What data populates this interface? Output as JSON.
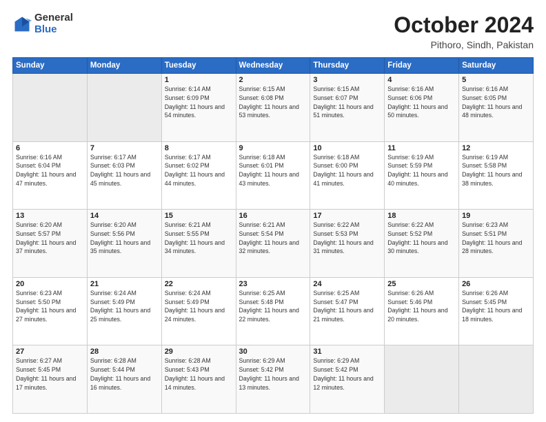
{
  "logo": {
    "general": "General",
    "blue": "Blue"
  },
  "header": {
    "month": "October 2024",
    "location": "Pithoro, Sindh, Pakistan"
  },
  "weekdays": [
    "Sunday",
    "Monday",
    "Tuesday",
    "Wednesday",
    "Thursday",
    "Friday",
    "Saturday"
  ],
  "weeks": [
    [
      {
        "day": "",
        "info": ""
      },
      {
        "day": "",
        "info": ""
      },
      {
        "day": "1",
        "info": "Sunrise: 6:14 AM\nSunset: 6:09 PM\nDaylight: 11 hours and 54 minutes."
      },
      {
        "day": "2",
        "info": "Sunrise: 6:15 AM\nSunset: 6:08 PM\nDaylight: 11 hours and 53 minutes."
      },
      {
        "day": "3",
        "info": "Sunrise: 6:15 AM\nSunset: 6:07 PM\nDaylight: 11 hours and 51 minutes."
      },
      {
        "day": "4",
        "info": "Sunrise: 6:16 AM\nSunset: 6:06 PM\nDaylight: 11 hours and 50 minutes."
      },
      {
        "day": "5",
        "info": "Sunrise: 6:16 AM\nSunset: 6:05 PM\nDaylight: 11 hours and 48 minutes."
      }
    ],
    [
      {
        "day": "6",
        "info": "Sunrise: 6:16 AM\nSunset: 6:04 PM\nDaylight: 11 hours and 47 minutes."
      },
      {
        "day": "7",
        "info": "Sunrise: 6:17 AM\nSunset: 6:03 PM\nDaylight: 11 hours and 45 minutes."
      },
      {
        "day": "8",
        "info": "Sunrise: 6:17 AM\nSunset: 6:02 PM\nDaylight: 11 hours and 44 minutes."
      },
      {
        "day": "9",
        "info": "Sunrise: 6:18 AM\nSunset: 6:01 PM\nDaylight: 11 hours and 43 minutes."
      },
      {
        "day": "10",
        "info": "Sunrise: 6:18 AM\nSunset: 6:00 PM\nDaylight: 11 hours and 41 minutes."
      },
      {
        "day": "11",
        "info": "Sunrise: 6:19 AM\nSunset: 5:59 PM\nDaylight: 11 hours and 40 minutes."
      },
      {
        "day": "12",
        "info": "Sunrise: 6:19 AM\nSunset: 5:58 PM\nDaylight: 11 hours and 38 minutes."
      }
    ],
    [
      {
        "day": "13",
        "info": "Sunrise: 6:20 AM\nSunset: 5:57 PM\nDaylight: 11 hours and 37 minutes."
      },
      {
        "day": "14",
        "info": "Sunrise: 6:20 AM\nSunset: 5:56 PM\nDaylight: 11 hours and 35 minutes."
      },
      {
        "day": "15",
        "info": "Sunrise: 6:21 AM\nSunset: 5:55 PM\nDaylight: 11 hours and 34 minutes."
      },
      {
        "day": "16",
        "info": "Sunrise: 6:21 AM\nSunset: 5:54 PM\nDaylight: 11 hours and 32 minutes."
      },
      {
        "day": "17",
        "info": "Sunrise: 6:22 AM\nSunset: 5:53 PM\nDaylight: 11 hours and 31 minutes."
      },
      {
        "day": "18",
        "info": "Sunrise: 6:22 AM\nSunset: 5:52 PM\nDaylight: 11 hours and 30 minutes."
      },
      {
        "day": "19",
        "info": "Sunrise: 6:23 AM\nSunset: 5:51 PM\nDaylight: 11 hours and 28 minutes."
      }
    ],
    [
      {
        "day": "20",
        "info": "Sunrise: 6:23 AM\nSunset: 5:50 PM\nDaylight: 11 hours and 27 minutes."
      },
      {
        "day": "21",
        "info": "Sunrise: 6:24 AM\nSunset: 5:49 PM\nDaylight: 11 hours and 25 minutes."
      },
      {
        "day": "22",
        "info": "Sunrise: 6:24 AM\nSunset: 5:49 PM\nDaylight: 11 hours and 24 minutes."
      },
      {
        "day": "23",
        "info": "Sunrise: 6:25 AM\nSunset: 5:48 PM\nDaylight: 11 hours and 22 minutes."
      },
      {
        "day": "24",
        "info": "Sunrise: 6:25 AM\nSunset: 5:47 PM\nDaylight: 11 hours and 21 minutes."
      },
      {
        "day": "25",
        "info": "Sunrise: 6:26 AM\nSunset: 5:46 PM\nDaylight: 11 hours and 20 minutes."
      },
      {
        "day": "26",
        "info": "Sunrise: 6:26 AM\nSunset: 5:45 PM\nDaylight: 11 hours and 18 minutes."
      }
    ],
    [
      {
        "day": "27",
        "info": "Sunrise: 6:27 AM\nSunset: 5:45 PM\nDaylight: 11 hours and 17 minutes."
      },
      {
        "day": "28",
        "info": "Sunrise: 6:28 AM\nSunset: 5:44 PM\nDaylight: 11 hours and 16 minutes."
      },
      {
        "day": "29",
        "info": "Sunrise: 6:28 AM\nSunset: 5:43 PM\nDaylight: 11 hours and 14 minutes."
      },
      {
        "day": "30",
        "info": "Sunrise: 6:29 AM\nSunset: 5:42 PM\nDaylight: 11 hours and 13 minutes."
      },
      {
        "day": "31",
        "info": "Sunrise: 6:29 AM\nSunset: 5:42 PM\nDaylight: 11 hours and 12 minutes."
      },
      {
        "day": "",
        "info": ""
      },
      {
        "day": "",
        "info": ""
      }
    ]
  ]
}
